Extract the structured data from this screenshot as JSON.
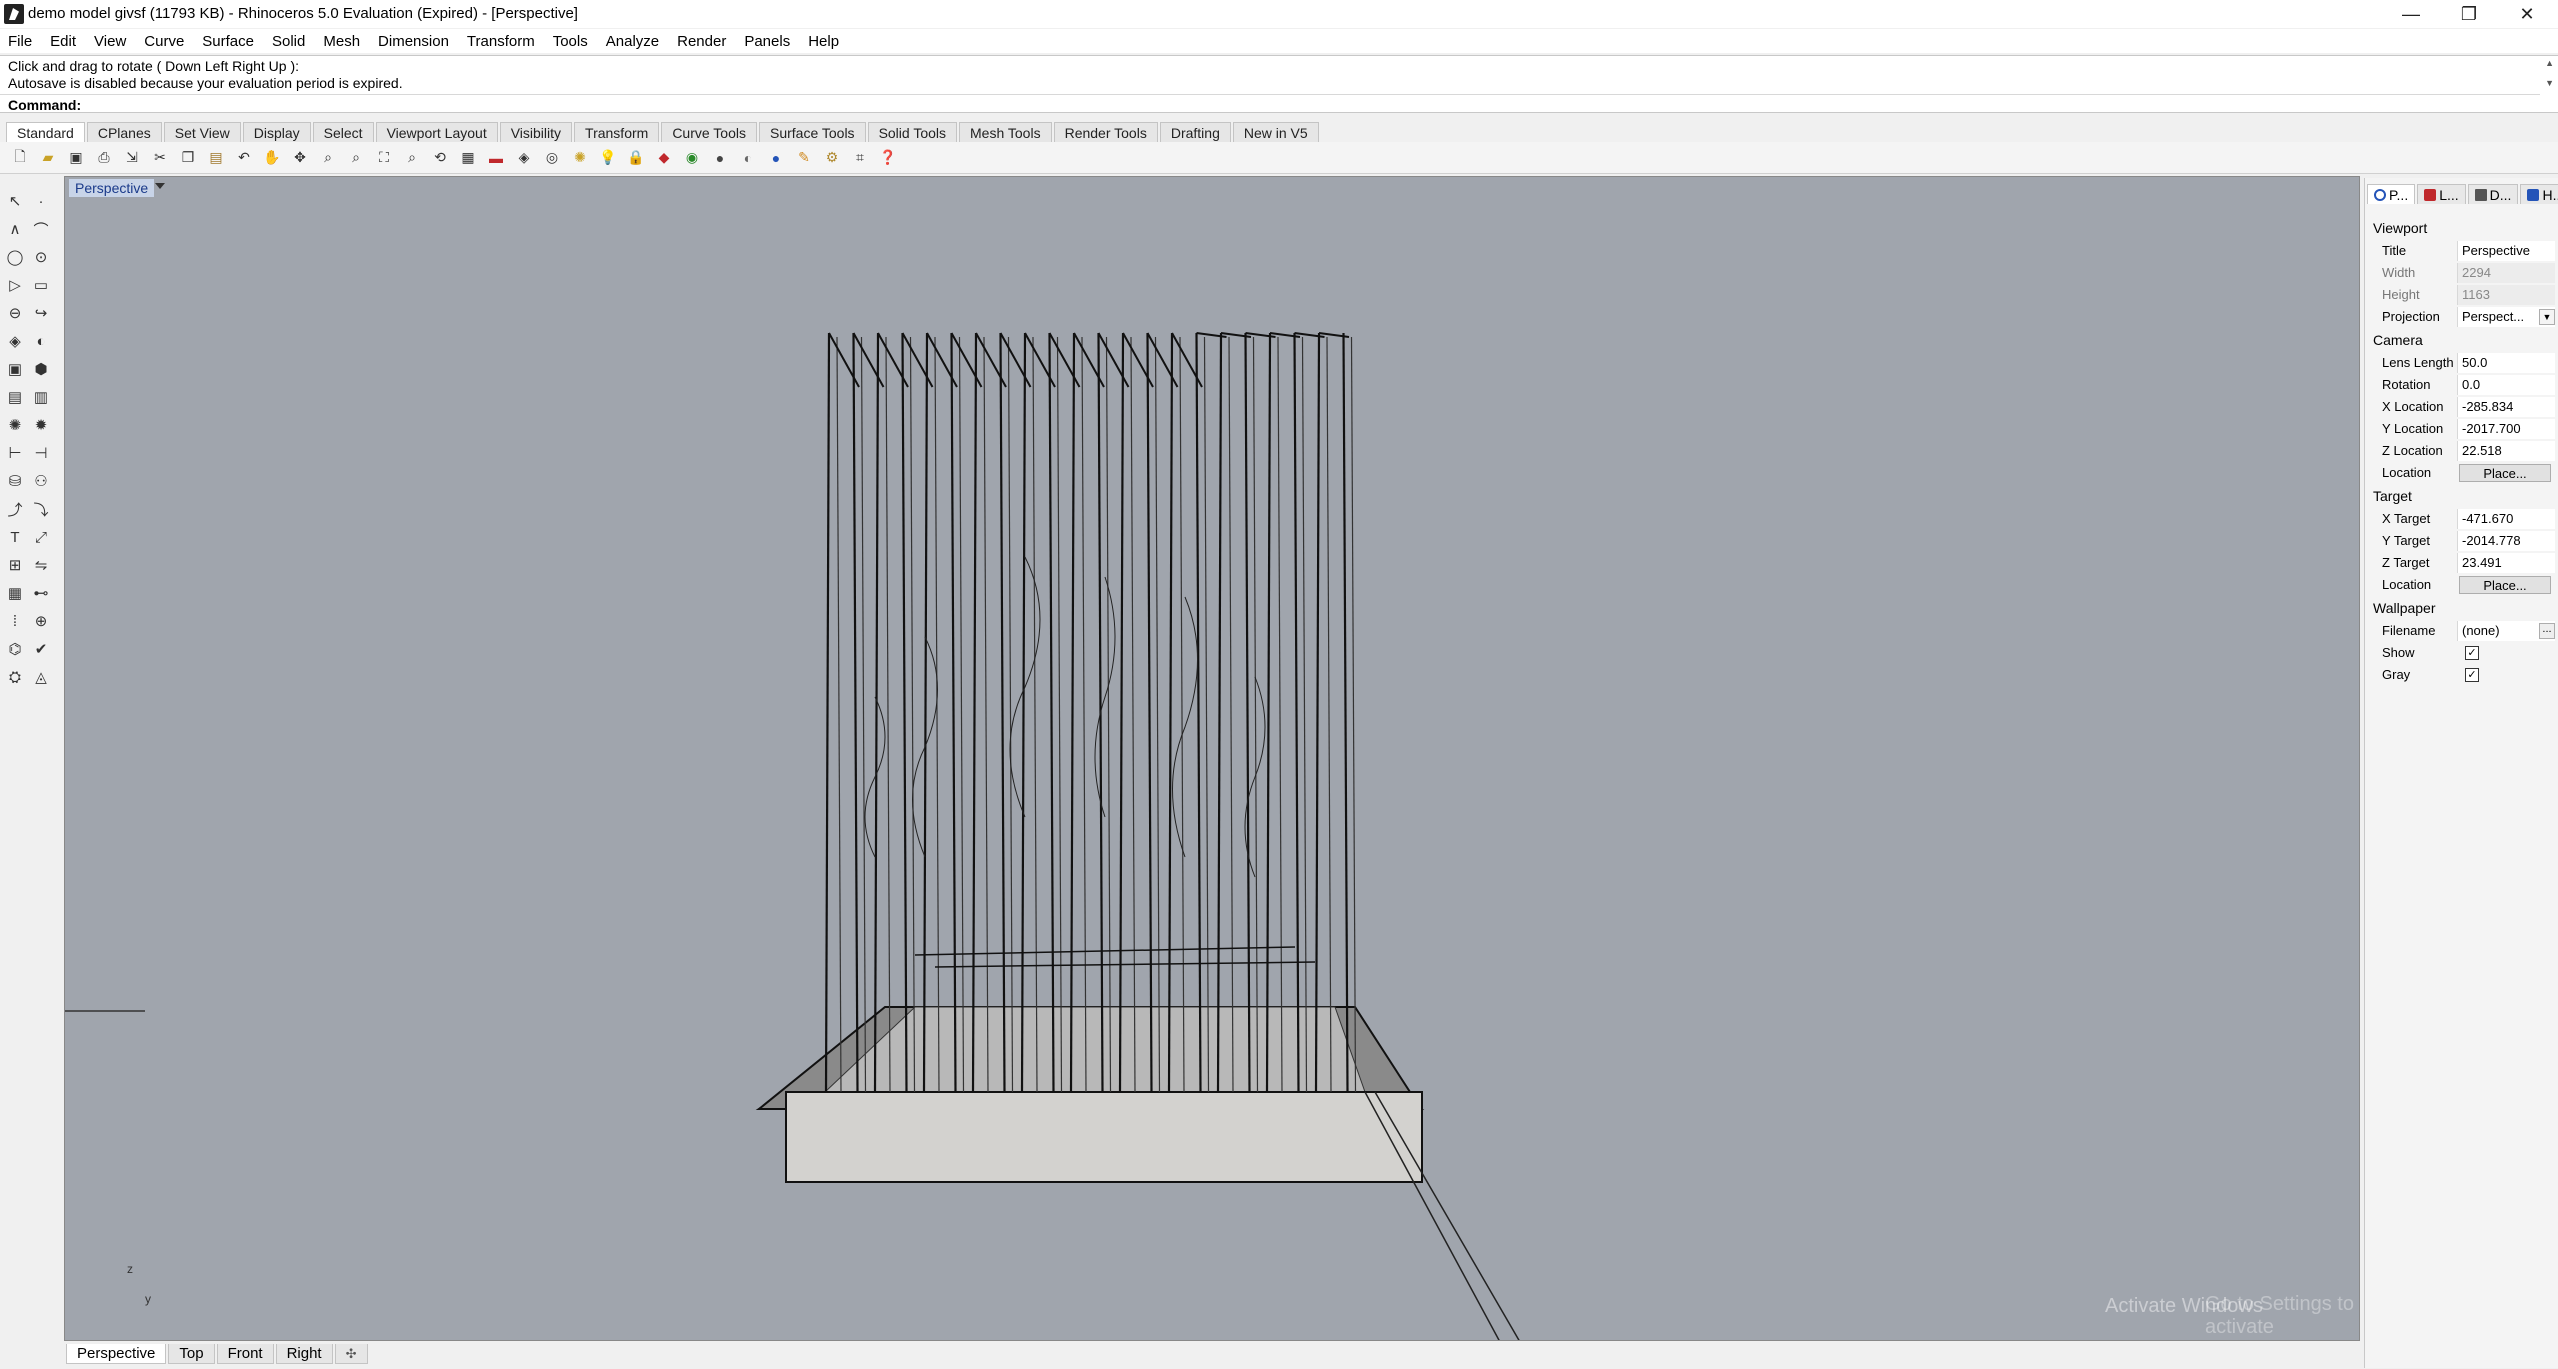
{
  "window": {
    "title": "demo model givsf (11793 KB) - Rhinoceros 5.0 Evaluation (Expired) - [Perspective]",
    "minimize_label": "—",
    "maximize_label": "❐",
    "close_label": "✕"
  },
  "menu": [
    "File",
    "Edit",
    "View",
    "Curve",
    "Surface",
    "Solid",
    "Mesh",
    "Dimension",
    "Transform",
    "Tools",
    "Analyze",
    "Render",
    "Panels",
    "Help"
  ],
  "command": {
    "history_line1": "Click and drag to rotate ( Down  Left  Right  Up ):",
    "history_line2": "Autosave is disabled because your evaluation period is expired.",
    "prompt_label": "Command:",
    "input_value": ""
  },
  "toolbar_tabs": [
    "Standard",
    "CPlanes",
    "Set View",
    "Display",
    "Select",
    "Viewport Layout",
    "Visibility",
    "Transform",
    "Curve Tools",
    "Surface Tools",
    "Solid Tools",
    "Mesh Tools",
    "Render Tools",
    "Drafting",
    "New in V5"
  ],
  "icons": {
    "standard_toolbar": [
      "new-file-icon",
      "open-file-icon",
      "save-icon",
      "print-icon",
      "export-icon",
      "cut-icon",
      "copy-icon",
      "paste-icon",
      "undo-icon",
      "pan-icon",
      "move-view-icon",
      "zoom-icon",
      "zoom-window-icon",
      "zoom-extents-icon",
      "zoom-selected-icon",
      "rotate-view-icon",
      "four-viewports-icon",
      "car-icon",
      "cplane-icon",
      "grid-icon",
      "lock-icon",
      "light-icon",
      "render-icon",
      "color-icon",
      "sphere-icon",
      "material-icon",
      "globe-icon",
      "pencil-icon",
      "gear-tools-icon",
      "dims-icon",
      "help-icon"
    ]
  },
  "viewport": {
    "label": "Perspective",
    "axis_z": "z",
    "axis_y": "y",
    "watermark": "Activate Windows",
    "watermark_sub": "Go to Settings to activate Windows."
  },
  "viewport_tabs": [
    "Perspective",
    "Top",
    "Front",
    "Right"
  ],
  "panel_tabs": [
    "P...",
    "L...",
    "D...",
    "H..."
  ],
  "properties": {
    "viewport_section": "Viewport",
    "title_label": "Title",
    "title_value": "Perspective",
    "width_label": "Width",
    "width_value": "2294",
    "height_label": "Height",
    "height_value": "1163",
    "projection_label": "Projection",
    "projection_value": "Perspect...",
    "camera_section": "Camera",
    "lens_label": "Lens Length",
    "lens_value": "50.0",
    "rotation_label": "Rotation",
    "rotation_value": "0.0",
    "xloc_label": "X Location",
    "xloc_value": "-285.834",
    "yloc_label": "Y Location",
    "yloc_value": "-2017.700",
    "zloc_label": "Z Location",
    "zloc_value": "22.518",
    "location_label": "Location",
    "place_button": "Place...",
    "target_section": "Target",
    "xt_label": "X Target",
    "xt_value": "-471.670",
    "yt_label": "Y Target",
    "yt_value": "-2014.778",
    "zt_label": "Z Target",
    "zt_value": "23.491",
    "tlocation_label": "Location",
    "tplace_button": "Place...",
    "wallpaper_section": "Wallpaper",
    "filename_label": "Filename",
    "filename_value": "(none)",
    "show_label": "Show",
    "show_checked": true,
    "gray_label": "Gray",
    "gray_checked": true
  }
}
